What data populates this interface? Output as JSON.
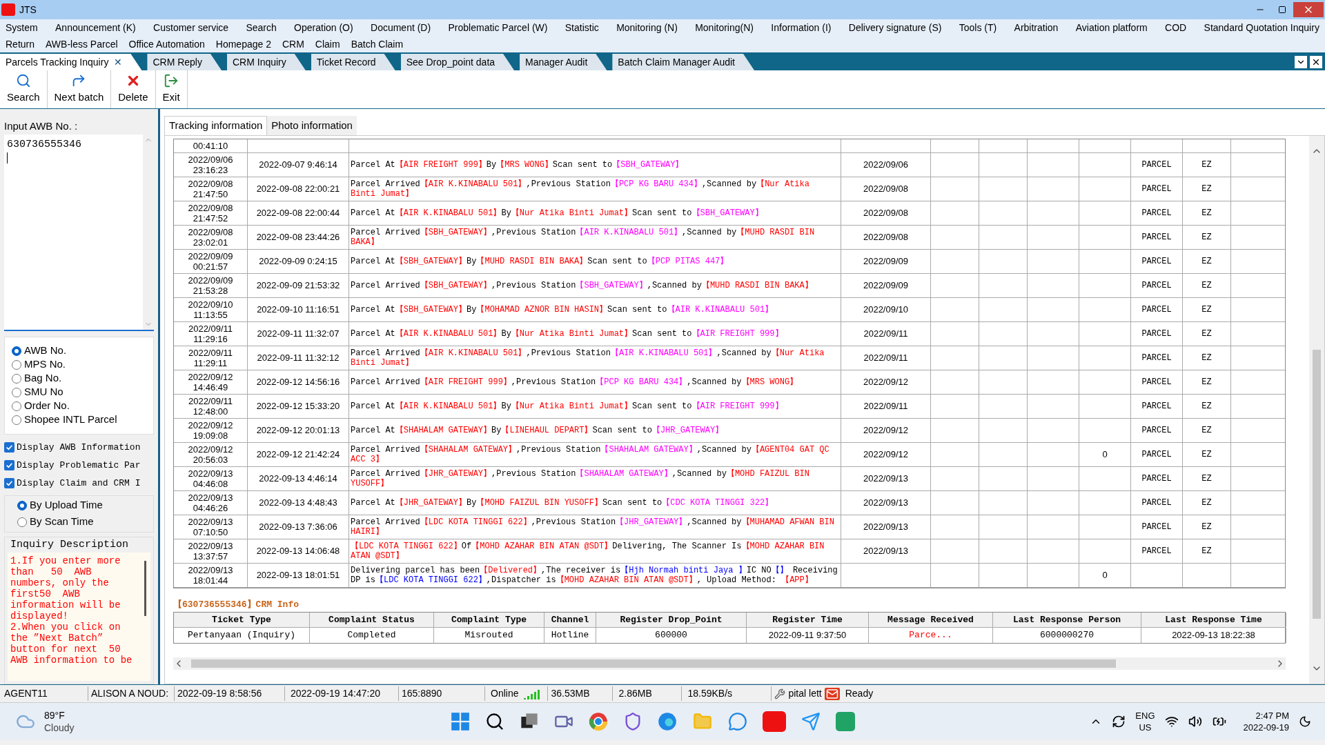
{
  "window": {
    "title": "JTS"
  },
  "menu_rows": [
    [
      "System",
      "Announcement (K)",
      "Customer service",
      "Search",
      "Operation (O)",
      "Document (D)",
      "Problematic Parcel (W)",
      "Statistic",
      "Monitoring (N)",
      "Monitoring(N)",
      "Information (I)",
      "Delivery signature (S)",
      "Tools (T)",
      "Arbitration",
      "Aviation platform",
      "COD",
      "Standard Quotation Inquiry"
    ],
    [
      "Return",
      "AWB-less Parcel",
      "Office Automation",
      "Homepage 2",
      "CRM",
      "Claim",
      "Batch Claim"
    ]
  ],
  "tabs": [
    {
      "label": "Parcels Tracking Inquiry",
      "close": "✕",
      "selected": true
    },
    {
      "label": "CRM Reply",
      "selected": false
    },
    {
      "label": "CRM Inquiry",
      "selected": false
    },
    {
      "label": "Ticket Record",
      "selected": false
    },
    {
      "label": "See Drop_point data",
      "selected": false
    },
    {
      "label": "Manager Audit",
      "selected": false
    },
    {
      "label": "Batch Claim Manager Audit",
      "selected": false
    }
  ],
  "toolbar": [
    {
      "kind": "search",
      "label": "Search"
    },
    {
      "kind": "next",
      "label": "Next batch"
    },
    {
      "kind": "delete",
      "label": "Delete"
    },
    {
      "kind": "exit",
      "label": "Exit"
    }
  ],
  "left_panel": {
    "input_label": "Input AWB No. :",
    "input_value": "630736555346",
    "search_by": [
      {
        "label": "AWB No.",
        "selected": true
      },
      {
        "label": "MPS No.",
        "selected": false
      },
      {
        "label": "Bag No.",
        "selected": false
      },
      {
        "label": "SMU No",
        "selected": false
      },
      {
        "label": "Order No.",
        "selected": false
      },
      {
        "label": "Shopee INTL Parcel",
        "selected": false
      }
    ],
    "options": [
      {
        "label": "Display AWB Information",
        "checked": true
      },
      {
        "label": "Display Problematic Par",
        "checked": true
      },
      {
        "label": "Display Claim and CRM I",
        "checked": true
      }
    ],
    "time_mode": [
      {
        "label": "By Upload Time",
        "selected": true
      },
      {
        "label": "By Scan Time",
        "selected": false
      }
    ],
    "description_title": "Inquiry Description",
    "description": "1.If you enter more than   50  AWB numbers, only the first50  AWB information will be displayed!\n2.When you click on the ”Next Batch” button for next  50 AWB information to be"
  },
  "subtabs": [
    {
      "label": "Tracking information",
      "selected": true
    },
    {
      "label": "Photo information",
      "selected": false
    }
  ],
  "tracking_rows": [
    {
      "scan_time": "00:41:10"
    },
    {
      "scan_time": "2022/09/06 23:16:23",
      "upload_time": "2022-09-07 9:46:14",
      "segments": [
        {
          "text": "Parcel At",
          "color": "#000000"
        },
        {
          "text": "【AIR FREIGHT 999】",
          "color": "#ff0000"
        },
        {
          "text": "By",
          "color": "#000000"
        },
        {
          "text": "【MRS WONG】",
          "color": "#ff0000"
        },
        {
          "text": "Scan sent to",
          "color": "#000000"
        },
        {
          "text": "【SBH_GATEWAY】",
          "color": "#ff00ff"
        }
      ],
      "date": "2022/09/06",
      "column_10": "PARCEL",
      "column_11": "EZ"
    },
    {
      "scan_time": "2022/09/08 21:47:50",
      "upload_time": "2022-09-08 22:00:21",
      "segments": [
        {
          "text": "Parcel Arrived",
          "color": "#000000"
        },
        {
          "text": "【AIR K.KINABALU 501】",
          "color": "#ff0000"
        },
        {
          "text": ",Previous Station",
          "color": "#000000"
        },
        {
          "text": "【PCP KG BARU 434】",
          "color": "#ff00ff"
        },
        {
          "text": ",Scanned by",
          "color": "#000000"
        },
        {
          "text": "【Nur Atika Binti Jumat】",
          "color": "#ff0000"
        }
      ],
      "date": "2022/09/08",
      "column_10": "PARCEL",
      "column_11": "EZ"
    },
    {
      "scan_time": "2022/09/08 21:47:52",
      "upload_time": "2022-09-08 22:00:44",
      "segments": [
        {
          "text": "Parcel At",
          "color": "#000000"
        },
        {
          "text": "【AIR K.KINABALU 501】",
          "color": "#ff0000"
        },
        {
          "text": "By",
          "color": "#000000"
        },
        {
          "text": "【Nur Atika Binti Jumat】",
          "color": "#ff0000"
        },
        {
          "text": "Scan sent to",
          "color": "#000000"
        },
        {
          "text": "【SBH_GATEWAY】",
          "color": "#ff00ff"
        }
      ],
      "date": "2022/09/08",
      "column_10": "PARCEL",
      "column_11": "EZ"
    },
    {
      "scan_time": "2022/09/08 23:02:01",
      "upload_time": "2022-09-08 23:44:26",
      "segments": [
        {
          "text": "Parcel Arrived",
          "color": "#000000"
        },
        {
          "text": "【SBH_GATEWAY】",
          "color": "#ff0000"
        },
        {
          "text": ",Previous Station",
          "color": "#000000"
        },
        {
          "text": "【AIR K.KINABALU 501】",
          "color": "#ff00ff"
        },
        {
          "text": ",Scanned by",
          "color": "#000000"
        },
        {
          "text": "【MUHD RASDI BIN BAKA】",
          "color": "#ff0000"
        }
      ],
      "date": "2022/09/08",
      "column_10": "PARCEL",
      "column_11": "EZ"
    },
    {
      "scan_time": "2022/09/09 00:21:57",
      "upload_time": "2022-09-09 0:24:15",
      "segments": [
        {
          "text": "Parcel At",
          "color": "#000000"
        },
        {
          "text": "【SBH_GATEWAY】",
          "color": "#ff0000"
        },
        {
          "text": "By",
          "color": "#000000"
        },
        {
          "text": "【MUHD RASDI BIN BAKA】",
          "color": "#ff0000"
        },
        {
          "text": "Scan sent to",
          "color": "#000000"
        },
        {
          "text": "【PCP PITAS 447】",
          "color": "#ff00ff"
        }
      ],
      "date": "2022/09/09",
      "column_10": "PARCEL",
      "column_11": "EZ"
    },
    {
      "scan_time": "2022/09/09 21:53:28",
      "upload_time": "2022-09-09 21:53:32",
      "segments": [
        {
          "text": "Parcel Arrived",
          "color": "#000000"
        },
        {
          "text": "【SBH_GATEWAY】",
          "color": "#ff0000"
        },
        {
          "text": ",Previous Station",
          "color": "#000000"
        },
        {
          "text": "【SBH_GATEWAY】",
          "color": "#ff00ff"
        },
        {
          "text": ",Scanned by",
          "color": "#000000"
        },
        {
          "text": "【MUHD RASDI BIN BAKA】",
          "color": "#ff0000"
        }
      ],
      "date": "2022/09/09",
      "column_10": "PARCEL",
      "column_11": "EZ"
    },
    {
      "scan_time": "2022/09/10 11:13:55",
      "upload_time": "2022-09-10 11:16:51",
      "segments": [
        {
          "text": "Parcel At",
          "color": "#000000"
        },
        {
          "text": "【SBH_GATEWAY】",
          "color": "#ff0000"
        },
        {
          "text": "By",
          "color": "#000000"
        },
        {
          "text": "【MOHAMAD AZNOR BIN HASIN】",
          "color": "#ff0000"
        },
        {
          "text": "Scan sent to",
          "color": "#000000"
        },
        {
          "text": "【AIR K.KINABALU 501】",
          "color": "#ff00ff"
        }
      ],
      "date": "2022/09/10",
      "column_10": "PARCEL",
      "column_11": "EZ"
    },
    {
      "scan_time": "2022/09/11 11:29:16",
      "upload_time": "2022-09-11 11:32:07",
      "segments": [
        {
          "text": "Parcel At",
          "color": "#000000"
        },
        {
          "text": "【AIR K.KINABALU 501】",
          "color": "#ff0000"
        },
        {
          "text": "By",
          "color": "#000000"
        },
        {
          "text": "【Nur Atika Binti Jumat】",
          "color": "#ff0000"
        },
        {
          "text": "Scan sent to",
          "color": "#000000"
        },
        {
          "text": "【AIR FREIGHT 999】",
          "color": "#ff00ff"
        }
      ],
      "date": "2022/09/11",
      "column_10": "PARCEL",
      "column_11": "EZ"
    },
    {
      "scan_time": "2022/09/11 11:29:11",
      "upload_time": "2022-09-11 11:32:12",
      "segments": [
        {
          "text": "Parcel Arrived",
          "color": "#000000"
        },
        {
          "text": "【AIR K.KINABALU 501】",
          "color": "#ff0000"
        },
        {
          "text": ",Previous Station",
          "color": "#000000"
        },
        {
          "text": "【AIR K.KINABALU 501】",
          "color": "#ff00ff"
        },
        {
          "text": ",Scanned by",
          "color": "#000000"
        },
        {
          "text": "【Nur Atika Binti Jumat】",
          "color": "#ff0000"
        }
      ],
      "date": "2022/09/11",
      "column_10": "PARCEL",
      "column_11": "EZ"
    },
    {
      "scan_time": "2022/09/12 14:46:49",
      "upload_time": "2022-09-12 14:56:16",
      "segments": [
        {
          "text": "Parcel Arrived",
          "color": "#000000"
        },
        {
          "text": "【AIR FREIGHT 999】",
          "color": "#ff0000"
        },
        {
          "text": ",Previous Station",
          "color": "#000000"
        },
        {
          "text": "【PCP KG BARU 434】",
          "color": "#ff00ff"
        },
        {
          "text": ",Scanned by",
          "color": "#000000"
        },
        {
          "text": "【MRS WONG】",
          "color": "#ff0000"
        }
      ],
      "date": "2022/09/12",
      "column_10": "PARCEL",
      "column_11": "EZ"
    },
    {
      "scan_time": "2022/09/11 12:48:00",
      "upload_time": "2022-09-12 15:33:20",
      "segments": [
        {
          "text": "Parcel At",
          "color": "#000000"
        },
        {
          "text": "【AIR K.KINABALU 501】",
          "color": "#ff0000"
        },
        {
          "text": "By",
          "color": "#000000"
        },
        {
          "text": "【Nur Atika Binti Jumat】",
          "color": "#ff0000"
        },
        {
          "text": "Scan sent to",
          "color": "#000000"
        },
        {
          "text": "【AIR FREIGHT 999】",
          "color": "#ff00ff"
        }
      ],
      "date": "2022/09/11",
      "column_10": "PARCEL",
      "column_11": "EZ"
    },
    {
      "scan_time": "2022/09/12 19:09:08",
      "upload_time": "2022-09-12 20:01:13",
      "segments": [
        {
          "text": "Parcel At",
          "color": "#000000"
        },
        {
          "text": "【SHAHALAM GATEWAY】",
          "color": "#ff0000"
        },
        {
          "text": "By",
          "color": "#000000"
        },
        {
          "text": "【LINEHAUL DEPART】",
          "color": "#ff0000"
        },
        {
          "text": "Scan sent to",
          "color": "#000000"
        },
        {
          "text": "【JHR_GATEWAY】",
          "color": "#ff00ff"
        }
      ],
      "date": "2022/09/12",
      "column_10": "PARCEL",
      "column_11": "EZ"
    },
    {
      "scan_time": "2022/09/12 20:56:03",
      "upload_time": "2022-09-12 21:42:24",
      "segments": [
        {
          "text": "Parcel Arrived",
          "color": "#000000"
        },
        {
          "text": "【SHAHALAM GATEWAY】",
          "color": "#ff0000"
        },
        {
          "text": ",Previous Station",
          "color": "#000000"
        },
        {
          "text": "【SHAHALAM GATEWAY】",
          "color": "#ff00ff"
        },
        {
          "text": ",Scanned by",
          "color": "#000000"
        },
        {
          "text": "【AGENT04 GAT QC ACC 3】",
          "color": "#ff0000"
        }
      ],
      "date": "2022/09/12",
      "column_8": "0",
      "column_10": "PARCEL",
      "column_11": "EZ"
    },
    {
      "scan_time": "2022/09/13 04:46:08",
      "upload_time": "2022-09-13 4:46:14",
      "segments": [
        {
          "text": "Parcel Arrived",
          "color": "#000000"
        },
        {
          "text": "【JHR_GATEWAY】",
          "color": "#ff0000"
        },
        {
          "text": ",Previous Station",
          "color": "#000000"
        },
        {
          "text": "【SHAHALAM GATEWAY】",
          "color": "#ff00ff"
        },
        {
          "text": ",Scanned by",
          "color": "#000000"
        },
        {
          "text": "【MOHD FAIZUL BIN YUSOFF】",
          "color": "#ff0000"
        }
      ],
      "date": "2022/09/13",
      "column_10": "PARCEL",
      "column_11": "EZ"
    },
    {
      "scan_time": "2022/09/13 04:46:26",
      "upload_time": "2022-09-13 4:48:43",
      "segments": [
        {
          "text": "Parcel At",
          "color": "#000000"
        },
        {
          "text": "【JHR_GATEWAY】",
          "color": "#ff0000"
        },
        {
          "text": "By",
          "color": "#000000"
        },
        {
          "text": "【MOHD FAIZUL BIN YUSOFF】",
          "color": "#ff0000"
        },
        {
          "text": "Scan sent to",
          "color": "#000000"
        },
        {
          "text": "【CDC KOTA TINGGI 322】",
          "color": "#ff00ff"
        }
      ],
      "date": "2022/09/13",
      "column_10": "PARCEL",
      "column_11": "EZ"
    },
    {
      "scan_time": "2022/09/13 07:10:50",
      "upload_time": "2022-09-13 7:36:06",
      "segments": [
        {
          "text": "Parcel Arrived",
          "color": "#000000"
        },
        {
          "text": "【LDC KOTA TINGGI 622】",
          "color": "#ff0000"
        },
        {
          "text": ",Previous Station",
          "color": "#000000"
        },
        {
          "text": "【JHR_GATEWAY】",
          "color": "#ff00ff"
        },
        {
          "text": ",Scanned by",
          "color": "#000000"
        },
        {
          "text": "【MUHAMAD AFWAN BIN HAIRI】",
          "color": "#ff0000"
        }
      ],
      "date": "2022/09/13",
      "column_10": "PARCEL",
      "column_11": "EZ"
    },
    {
      "scan_time": "2022/09/13 13:37:57",
      "upload_time": "2022-09-13 14:06:48",
      "segments": [
        {
          "text": "【LDC KOTA TINGGI 622】",
          "color": "#ff0000"
        },
        {
          "text": "Of",
          "color": "#000000"
        },
        {
          "text": "【MOHD AZAHAR BIN ATAN @SDT】",
          "color": "#ff0000"
        },
        {
          "text": "Delivering, The Scanner Is",
          "color": "#000000"
        },
        {
          "text": "【MOHD AZAHAR BIN ATAN @SDT】",
          "color": "#ff0000"
        }
      ],
      "date": "2022/09/13",
      "column_10": "PARCEL",
      "column_11": "EZ"
    },
    {
      "scan_time": "2022/09/13 18:01:44",
      "upload_time": "2022-09-13 18:01:51",
      "segments": [
        {
          "text": "Delivering parcel has been",
          "color": "#000000"
        },
        {
          "text": "【Delivered】",
          "color": "#ff0000"
        },
        {
          "text": ",The receiver is",
          "color": "#000000"
        },
        {
          "text": "【Hjh Normah binti Jaya 】",
          "color": "#0000ff"
        },
        {
          "text": "IC NO",
          "color": "#000000"
        },
        {
          "text": "【】",
          "color": "#0000ff"
        },
        {
          "text": " Receiving DP is",
          "color": "#000000"
        },
        {
          "text": "【LDC KOTA TINGGI 622】",
          "color": "#0000ff"
        },
        {
          "text": ",Dispatcher is",
          "color": "#000000"
        },
        {
          "text": "【MOHD AZAHAR BIN ATAN @SDT】",
          "color": "#ff0000"
        },
        {
          "text": ", Upload Method: ",
          "color": "#000000"
        },
        {
          "text": "【APP】",
          "color": "#ff0000"
        }
      ],
      "column_8": "0"
    }
  ],
  "crm": {
    "title": "【630736555346】CRM Info",
    "columns": [
      "Ticket Type",
      "Complaint Status",
      "Complaint Type",
      "Channel",
      "Register Drop_Point",
      "Register Time",
      "Message Received",
      "Last Response Person",
      "Last Response Time"
    ],
    "rows": [
      [
        "Pertanyaan (Inquiry)",
        "Completed",
        "Misrouted",
        "Hotline",
        "600000",
        "2022-09-11 9:37:50",
        "Parce...",
        "6000000270",
        "2022-09-13 18:22:38"
      ]
    ]
  },
  "status_bar": {
    "agent": "AGENT11",
    "user": "ALISON A NOUD:",
    "login_time": "2022-09-19 8:58:56",
    "current_time": "2022-09-19 14:47:20",
    "port": "165:8890",
    "connection": "Online",
    "memory": "36.53MB",
    "traffic": "2.86MB",
    "speed": "18.59KB/s",
    "notice": "pital lett",
    "state": "Ready"
  },
  "taskbar": {
    "temperature": "89°F",
    "weather": "Cloudy",
    "language": "ENG",
    "region": "US",
    "time": "2:47 PM",
    "date": "2022-09-19"
  }
}
